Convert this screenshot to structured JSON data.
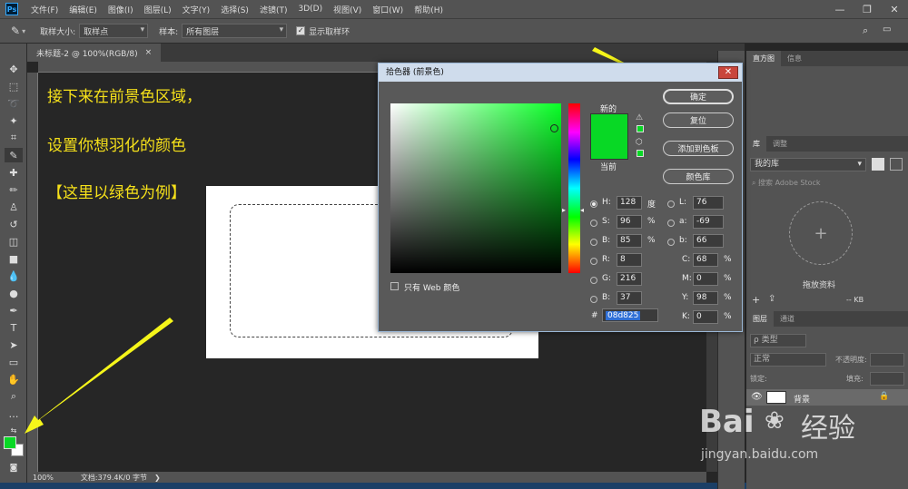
{
  "app": {
    "logo": "Ps"
  },
  "menubar": {
    "items": [
      "文件(F)",
      "编辑(E)",
      "图像(I)",
      "图层(L)",
      "文字(Y)",
      "选择(S)",
      "滤镜(T)",
      "3D(D)",
      "视图(V)",
      "窗口(W)",
      "帮助(H)"
    ]
  },
  "window_controls": {
    "minimize": "—",
    "maximize": "❐",
    "close": "✕"
  },
  "options": {
    "sample_size_label": "取样大小:",
    "sample_size_value": "取样点",
    "sample_label": "样本:",
    "sample_value": "所有图层",
    "show_ring_label": "显示取样环",
    "show_ring_checked": true
  },
  "document": {
    "tab_title": "未标题-2 @ 100%(RGB/8)",
    "tab_close": "×",
    "zoom": "100%",
    "doc_info": "文档:379.4K/0 字节"
  },
  "annotations": [
    "接下来在前景色区域，",
    "设置你想羽化的颜色",
    "【这里以绿色为例】"
  ],
  "colors": {
    "foreground": "#08d825",
    "background": "#ffffff",
    "accent_arrow": "#f5f51a"
  },
  "panels": {
    "top_tabs": [
      "直方图",
      "信息"
    ],
    "lib_tabs": [
      "库",
      "调整"
    ],
    "library_select": "我的库",
    "search_placeholder": "搜索 Adobe Stock",
    "drop_label": "拖放资料",
    "size_label": "-- KB",
    "layers_tabs": [
      "图层",
      "通道"
    ],
    "kind_label": "ρ 类型",
    "blend_mode": "正常",
    "opacity_label": "不透明度:",
    "lock_label": "锁定:",
    "fill_label": "填充:",
    "layer_name": "背景"
  },
  "picker": {
    "title": "拾色器 (前景色)",
    "close": "✕",
    "new_label": "新的",
    "current_label": "当前",
    "buttons": {
      "ok": "确定",
      "reset": "复位",
      "add_swatch": "添加到色板",
      "libraries": "颜色库"
    },
    "hsb": {
      "h": "128",
      "s": "96",
      "b": "85"
    },
    "rgb": {
      "r": "8",
      "g": "216",
      "b": "37"
    },
    "lab": {
      "l": "76",
      "a": "-69",
      "b": "66"
    },
    "cmyk": {
      "c": "68",
      "m": "0",
      "y": "98",
      "k": "0"
    },
    "labels": {
      "h": "H:",
      "s": "S:",
      "b": "B:",
      "r": "R:",
      "g": "G:",
      "bb": "B:",
      "l": "L:",
      "a": "a:",
      "lb": "b:",
      "c": "C:",
      "m": "M:",
      "y": "Y:",
      "k": "K:"
    },
    "units": {
      "deg": "度",
      "pct": "%"
    },
    "hash": "#",
    "hex": "08d825",
    "web_only_label": "只有 Web 颜色"
  },
  "watermark": {
    "brand": "Bai",
    "brand2": "经验",
    "url": "jingyan.baidu.com"
  }
}
